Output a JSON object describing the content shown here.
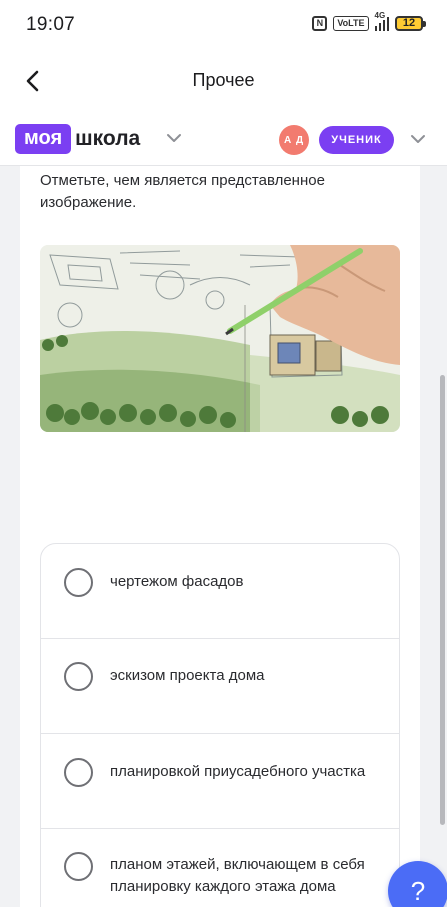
{
  "status_bar": {
    "time": "19:07",
    "net_label": "4G",
    "volte_label": "VoLTE",
    "nfc_label": "N",
    "battery": "12"
  },
  "header": {
    "back_icon": "chevron-left-icon",
    "title": "Прочее"
  },
  "brand": {
    "pill_text": "моя",
    "word": "школа",
    "accent_color": "#7b3ff2",
    "avatar_initials": "А Д",
    "avatar_color": "#f27b6f",
    "role_label": "УЧЕНИК"
  },
  "question": {
    "prompt": "Отметьте, чем является представленное изображение.",
    "options": [
      {
        "label": "чертежом фасадов",
        "selected": false
      },
      {
        "label": "эскизом проекта дома",
        "selected": false
      },
      {
        "label": "планировкой приусадебного участка",
        "selected": false
      },
      {
        "label": "планом этажей, включающем в себя планировку каждого этажа дома",
        "selected": false
      }
    ]
  },
  "help_button": {
    "label": "?",
    "color": "#4b6cf6"
  }
}
